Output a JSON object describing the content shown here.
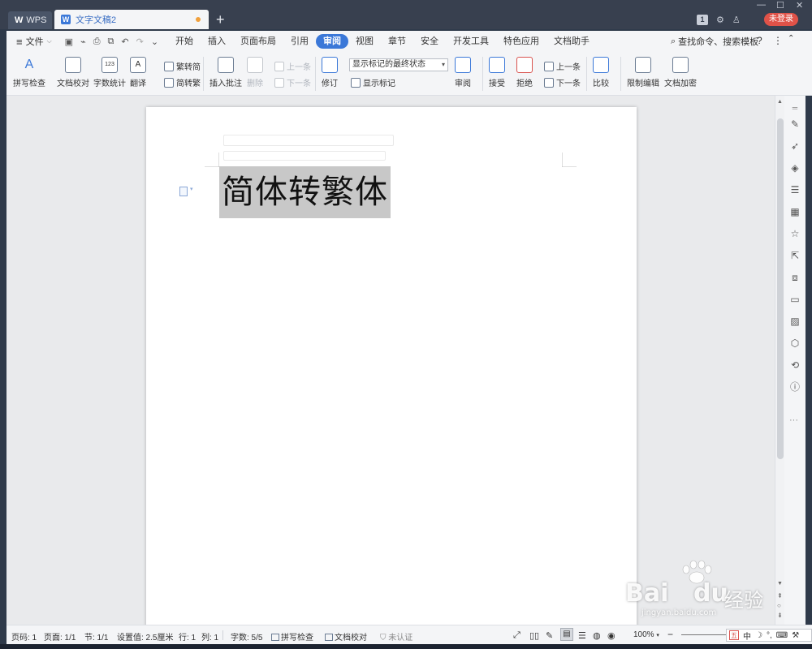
{
  "titlebar": {
    "wps_tab": "WPS",
    "doc_tab": "文字文稿2",
    "login": "未登录",
    "badge": "1"
  },
  "menubar": {
    "file": "文件",
    "items": [
      "开始",
      "插入",
      "页面布局",
      "引用",
      "审阅",
      "视图",
      "章节",
      "安全",
      "开发工具",
      "特色应用",
      "文档助手"
    ],
    "active": "审阅",
    "search": "查找命令、搜索模板"
  },
  "ribbon": {
    "spell_check": "拼写检查",
    "doc_proof": "文档校对",
    "word_count": "字数统计",
    "translate": "翻译",
    "to_simplified": "繁转简",
    "to_traditional": "简转繁",
    "insert_comment": "插入批注",
    "delete": "删除",
    "prev": "上一条",
    "next": "下一条",
    "track": "修订",
    "markup_dropdown": "显示标记的最终状态",
    "show_markup": "显示标记",
    "review": "审阅",
    "accept": "接受",
    "reject": "拒绝",
    "prev2": "上一条",
    "next2": "下一条",
    "compare": "比较",
    "restrict": "限制编辑",
    "encrypt": "文档加密"
  },
  "document": {
    "content": "简体转繁体"
  },
  "statusbar": {
    "page_num": "页码: 1",
    "pages": "页面: 1/1",
    "section": "节: 1/1",
    "setting": "设置值: 2.5厘米",
    "row": "行: 1",
    "col": "列: 1",
    "words": "字数: 5/5",
    "spell": "拼写检查",
    "proof": "文档校对",
    "auth": "未认证",
    "zoom": "100%"
  },
  "ime": {
    "lang": "中"
  },
  "watermark": {
    "brand": "Bai",
    "brand2": "du",
    "cn": "经验",
    "url": "jingyan.baidu.com"
  },
  "colors": {
    "accent": "#3b78d8",
    "titlebar": "#38404f",
    "login": "#e05248",
    "selection": "#c8c8c8"
  }
}
